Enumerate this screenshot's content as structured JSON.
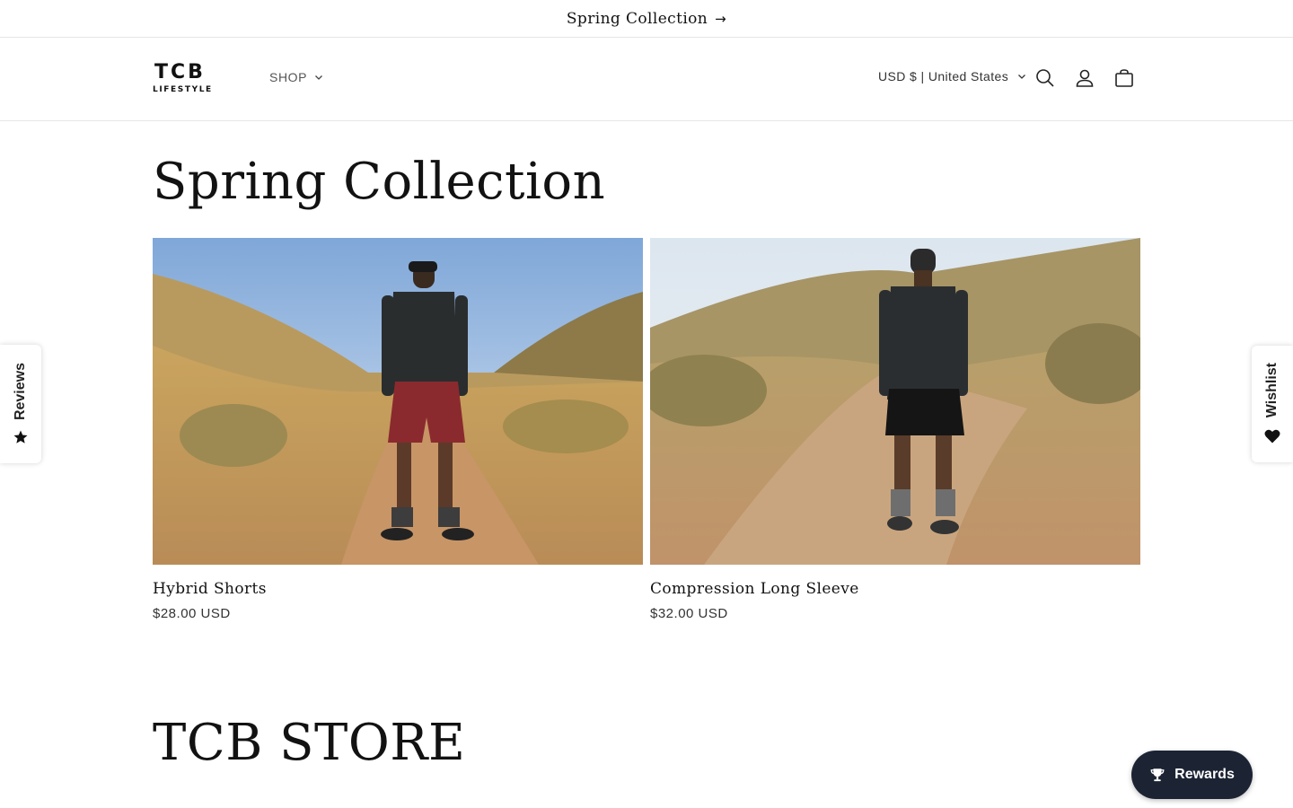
{
  "announcement": {
    "text": "Spring Collection",
    "icon": "arrow-right-icon"
  },
  "header": {
    "logo": {
      "mark": "TCB",
      "sub": "LIFESTYLE"
    },
    "nav": [
      {
        "label": "SHOP",
        "icon": "chevron-down-icon"
      }
    ],
    "currency_selector": {
      "value": "USD $ | United States"
    },
    "icons": [
      "search-icon",
      "account-icon",
      "cart-icon"
    ]
  },
  "collection": {
    "title": "Spring Collection",
    "products": [
      {
        "name": "Hybrid Shorts",
        "price": "$28.00 USD",
        "image": "man-in-maroon-shorts-on-trail"
      },
      {
        "name": "Compression Long Sleeve",
        "price": "$32.00 USD",
        "image": "man-in-black-compression-shirt-back-view"
      }
    ]
  },
  "store_section": {
    "title": "TCB STORE"
  },
  "widgets": {
    "reviews_tab": {
      "label": "Reviews",
      "icon": "star-icon"
    },
    "wishlist_tab": {
      "label": "Wishlist",
      "icon": "heart-icon"
    },
    "rewards_button": {
      "label": "Rewards",
      "icon": "trophy-icon"
    }
  },
  "colors": {
    "rewards_bg": "#1c2434",
    "text": "#121212",
    "divider": "#e6e6e6"
  }
}
